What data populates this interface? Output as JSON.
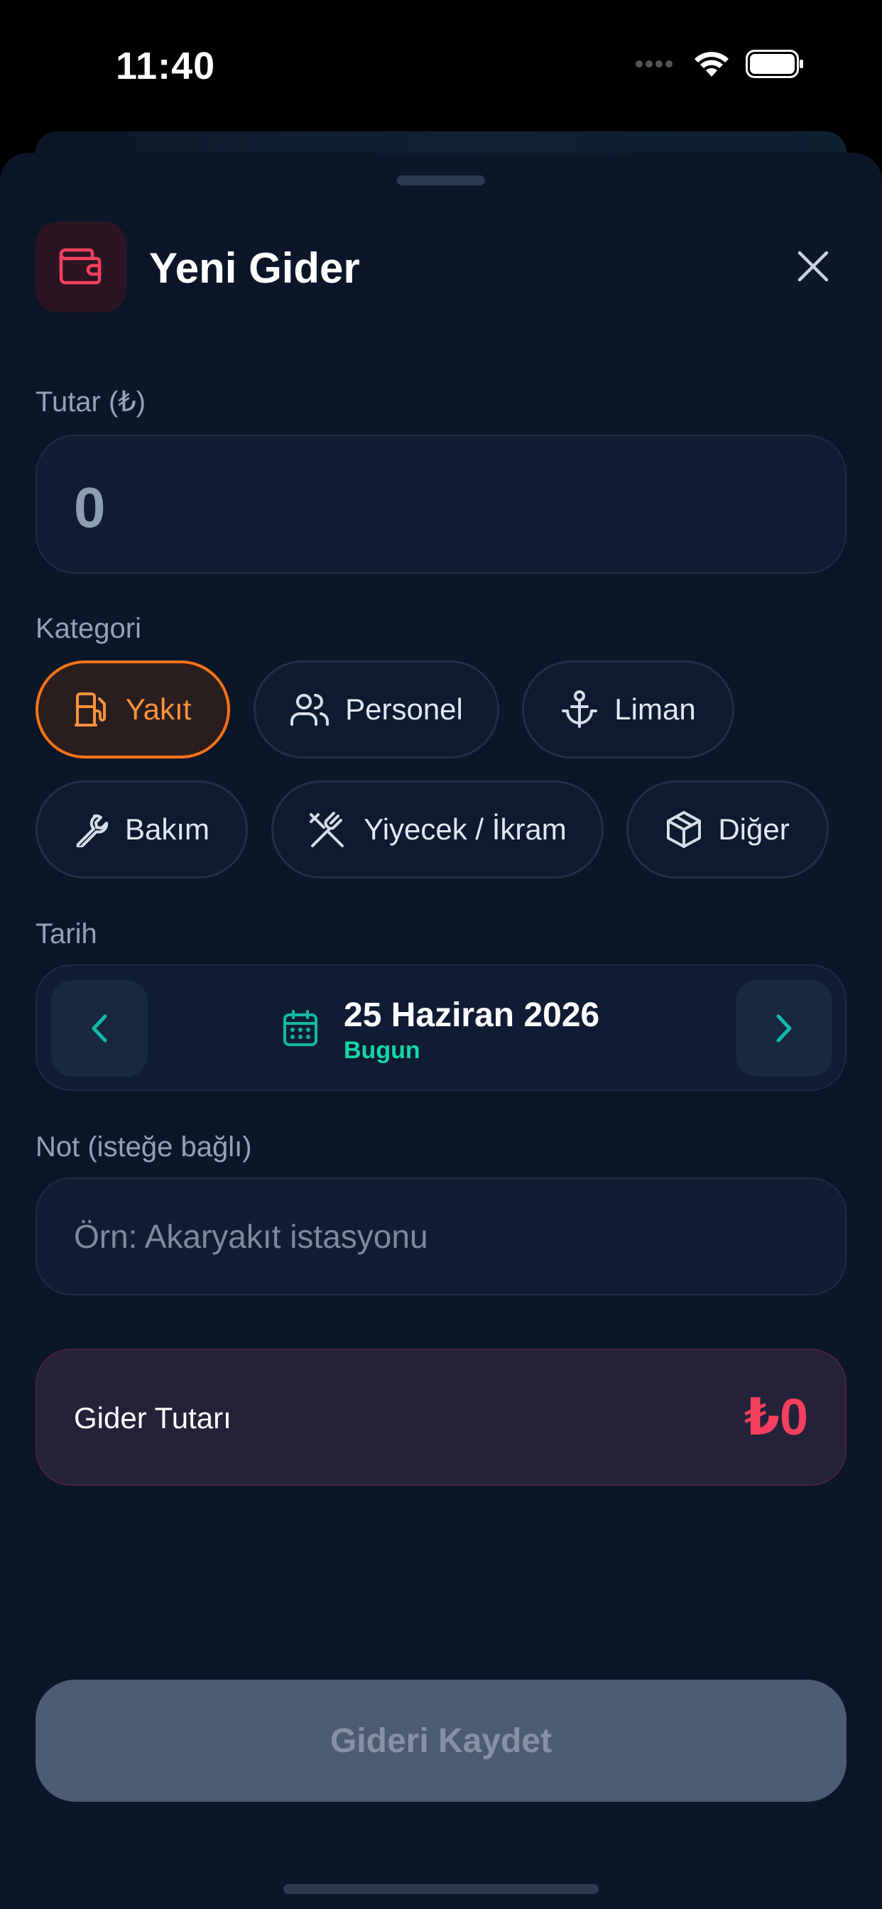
{
  "status_bar": {
    "time": "11:40"
  },
  "sheet": {
    "title": "Yeni Gider"
  },
  "amount": {
    "label": "Tutar (₺)",
    "value": "0"
  },
  "category": {
    "label": "Kategori",
    "chips": [
      {
        "label": "Yakıt",
        "icon": "fuel-pump-icon",
        "selected": true
      },
      {
        "label": "Personel",
        "icon": "users-icon",
        "selected": false
      },
      {
        "label": "Liman",
        "icon": "anchor-icon",
        "selected": false
      },
      {
        "label": "Bakım",
        "icon": "wrench-icon",
        "selected": false
      },
      {
        "label": "Yiyecek / İkram",
        "icon": "utensils-crossed-icon",
        "selected": false
      },
      {
        "label": "Diğer",
        "icon": "package-icon",
        "selected": false
      }
    ]
  },
  "date": {
    "label": "Tarih",
    "value": "25 Haziran 2026",
    "sub": "Bugun"
  },
  "note": {
    "label": "Not (isteğe bağlı)",
    "placeholder": "Örn: Akaryakıt istasyonu",
    "value": ""
  },
  "summary": {
    "label": "Gider Tutarı",
    "value": "₺0"
  },
  "save_button": {
    "label": "Gideri Kaydet"
  },
  "colors": {
    "background": "#0b1629",
    "accent_orange": "#f97316",
    "accent_teal": "#14d8a7",
    "accent_red": "#f43f5e"
  }
}
